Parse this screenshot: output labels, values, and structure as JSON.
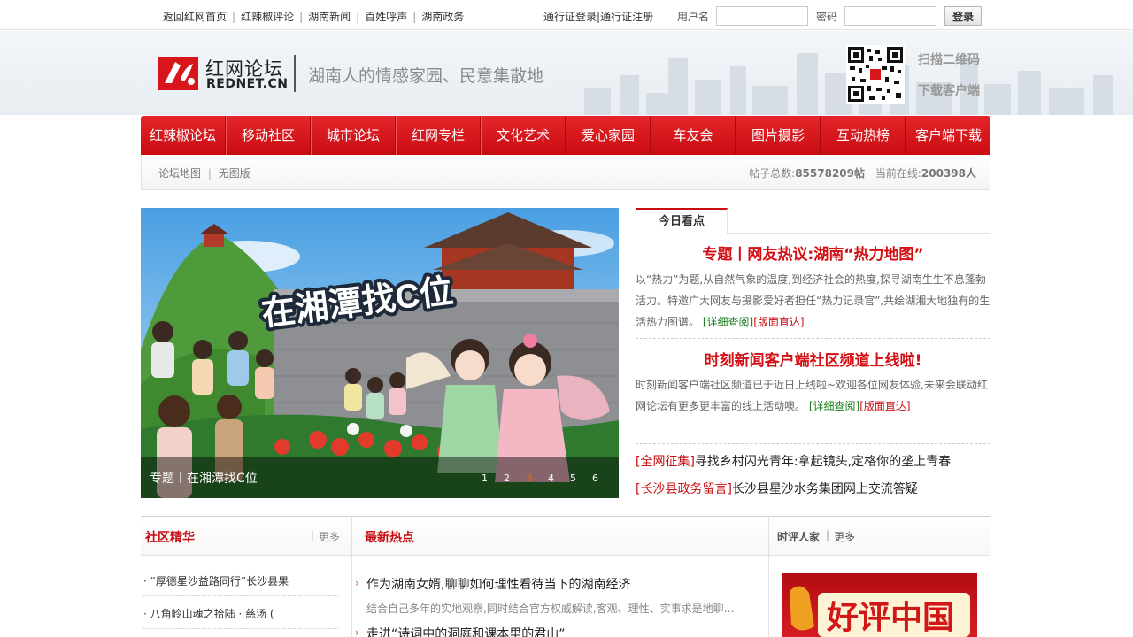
{
  "topbar": {
    "links": [
      "返回红网首页",
      "红辣椒评论",
      "湖南新闻",
      "百姓呼声",
      "湖南政务"
    ],
    "login_link": "通行证登录",
    "register_link": "通行证注册",
    "username_label": "用户名",
    "password_label": "密码",
    "login_button": "登录"
  },
  "header": {
    "logo_cn": "红网论坛",
    "logo_en": "REDNET.CN",
    "slogan": "湖南人的情感家园、民意集散地",
    "qr_line1": "扫描二维码",
    "qr_line2": "下载客户端"
  },
  "nav": {
    "items": [
      "红辣椒论坛",
      "移动社区",
      "城市论坛",
      "红网专栏",
      "文化艺术",
      "爱心家园",
      "车友会",
      "图片摄影",
      "互动热榜",
      "客户端下载"
    ]
  },
  "subbar": {
    "map_link": "论坛地图",
    "noimg_link": "无图版",
    "posts_label": "帖子总数:",
    "posts_value": "85578209帖",
    "online_label": "当前在线:",
    "online_value": "200398人"
  },
  "slider": {
    "caption": "专题丨在湘潭找C位",
    "banner_text": "在湘潭找C位",
    "dots": [
      "1",
      "2",
      "3",
      "4",
      "5",
      "6"
    ],
    "active_dot": 3
  },
  "today": {
    "tab": "今日看点",
    "item1": {
      "title": "专题丨网友热议:湖南“热力地图”",
      "text": "以“热力”为题,从自然气象的温度,到经济社会的热度,探寻湖南生生不息蓬勃活力。特邀广大网友与摄影爱好者担任“热力记录官”,共绘湖湘大地独有的生活热力图谱。",
      "detail": "[详细查阅]",
      "direct": "[版面直达]"
    },
    "item2": {
      "title": "时刻新闻客户端社区频道上线啦!",
      "text": "时刻新闻客户端社区频道已于近日上线啦~欢迎各位网友体验,未来会联动红网论坛有更多更丰富的线上活动噢。",
      "detail": "[详细查阅]",
      "direct": "[版面直达]"
    },
    "news": [
      {
        "tag": "[全网征集]",
        "text": "寻找乡村闪光青年:拿起镜头,定格你的垄上青春"
      },
      {
        "tag": "[长沙县政务留言]",
        "text": "长沙县星沙水务集团网上交流答疑"
      }
    ]
  },
  "community": {
    "title": "社区精华",
    "more": "更多",
    "items": [
      "· “厚德星沙益路同行”长沙县果",
      "· 八角岭山魂之拾陆 · 慈汤 ("
    ]
  },
  "hot": {
    "title": "最新热点",
    "items": [
      {
        "title": "作为湖南女婿,聊聊如何理性看待当下的湖南经济",
        "summary": "结合自己多年的实地观察,同时结合官方权威解读,客观、理性、实事求是地聊…"
      },
      {
        "title": "走进“诗词中的洞庭和课本里的君山”",
        "summary": ""
      }
    ]
  },
  "commentary": {
    "title": "时评人家",
    "more": "更多",
    "promo_text": "好评中国"
  }
}
